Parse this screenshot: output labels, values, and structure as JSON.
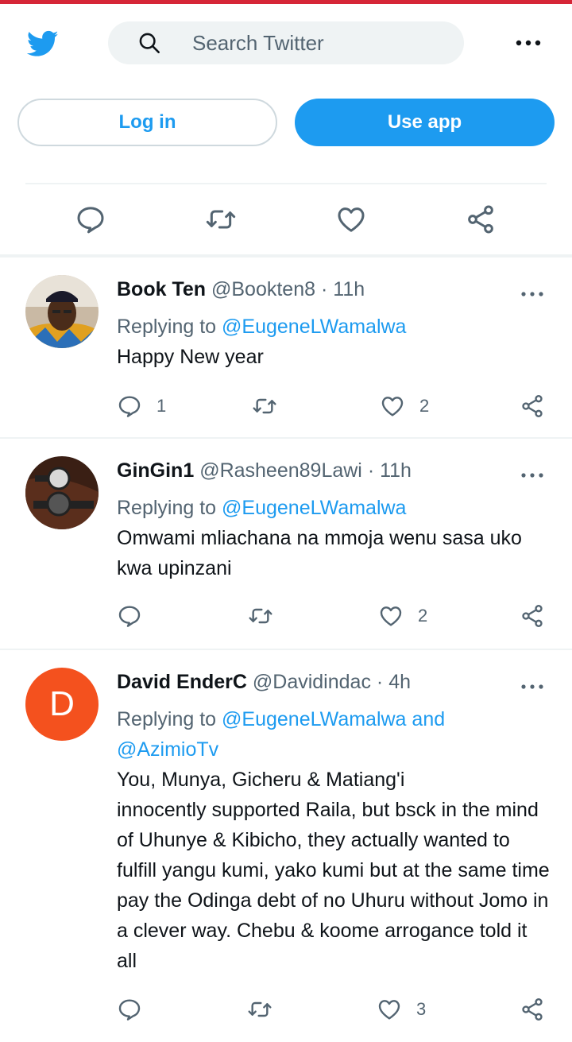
{
  "header": {
    "search_placeholder": "Search Twitter"
  },
  "auth": {
    "login_label": "Log in",
    "use_app_label": "Use app"
  },
  "icons": {
    "logo": "twitter-bird-icon",
    "search": "search-icon",
    "more": "more-dots-icon",
    "reply": "reply-bubble-icon",
    "retweet": "retweet-icon",
    "like": "heart-icon",
    "share": "share-icon"
  },
  "colors": {
    "accent": "#1d9bf0",
    "text": "#0f1419",
    "muted": "#536471",
    "top_bar": "#d62637",
    "avatar_d": "#f4511e"
  },
  "tweets": [
    {
      "name": "Book Ten",
      "handle": "@Bookten8",
      "dot": "·",
      "time": "11h",
      "replying_prefix": "Replying to",
      "replying_to": "@EugeneLWamalwa",
      "text": "Happy New year",
      "reply_count": "1",
      "retweet_count": "",
      "like_count": "2"
    },
    {
      "name": "GinGin1",
      "handle": "@Rasheen89Lawi",
      "dot": "·",
      "time": "11h",
      "replying_prefix": "Replying to",
      "replying_to": "@EugeneLWamalwa",
      "text": "Omwami mliachana na mmoja wenu sasa uko kwa upinzani",
      "reply_count": "",
      "retweet_count": "",
      "like_count": "2"
    },
    {
      "name": "David EnderC",
      "handle": "@Davidindac",
      "dot": "·",
      "time": "4h",
      "avatar_letter": "D",
      "replying_prefix": "Replying to",
      "replying_to": "@EugeneLWamalwa and @AzimioTv",
      "text": "You, Munya, Gicheru & Matiang'i\n innocently supported Raila, but bsck in the mind of Uhunye & Kibicho, they actually wanted to fulfill yangu kumi, yako kumi but at the same time pay the Odinga debt of no Uhuru without Jomo in a clever way. Chebu & koome arrogance told it all",
      "reply_count": "",
      "retweet_count": "",
      "like_count": "3"
    }
  ]
}
